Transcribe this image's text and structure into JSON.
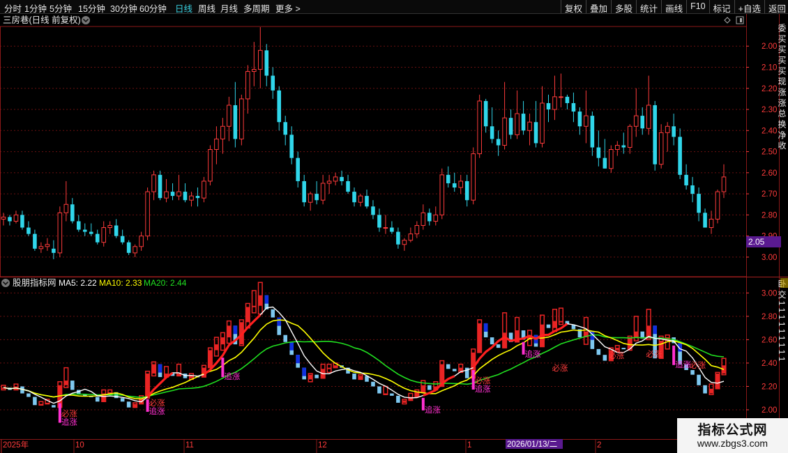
{
  "toolbar": {
    "items": [
      "分时",
      "1分钟",
      "5分钟",
      "15分钟",
      "30分钟",
      "60分钟",
      "日线",
      "周线",
      "月线",
      "多周期",
      "更多 >"
    ],
    "active_index": 6,
    "right_buttons": [
      "复权",
      "叠加",
      "多股",
      "统计",
      "画线",
      "F10",
      "标记",
      "+自选",
      "返回"
    ]
  },
  "main_chart": {
    "title": "三房巷(日线 前复权)",
    "y_ticks": [
      "3.00",
      "2.90",
      "2.80",
      "2.70",
      "2.60",
      "2.50",
      "2.40",
      "2.30",
      "2.20",
      "2.10",
      "2.00"
    ],
    "price_marker": "2.05",
    "side_text": "委 买 买 买 买 现 涨 涨 总 换 净 收"
  },
  "indicator": {
    "name": "股朋指标网",
    "ma5": "MA5: 2.22",
    "ma10": "MA10: 2.33",
    "ma20": "MA20: 2.44",
    "y_ticks": [
      "3.00",
      "2.80",
      "2.60",
      "2.40",
      "2.20",
      "2.00"
    ],
    "tag_up": "必涨",
    "tag_chase": "追涨",
    "side_text": "卧 交 1 1 1 1 1 1 1 1 1"
  },
  "time_axis": {
    "labels": [
      "2025年",
      "10",
      "11",
      "12",
      "1",
      "2"
    ],
    "cursor_label": "2026/01/13/二"
  },
  "watermark": {
    "title": "指标公式网",
    "url": "www.zbgs3.com"
  },
  "colors": {
    "up": "#ff3b3b",
    "down": "#30d6ea",
    "up_bar": "#e82424",
    "light_blue_bar": "#7ec8f0",
    "blue_bar": "#1030e0",
    "ma5": "#ffffff",
    "ma10": "#ffff00",
    "ma20": "#20e020",
    "tag": "#ff30d0",
    "grid": "#6b1010",
    "frame": "#8b1818"
  },
  "chart_data": [
    {
      "type": "candlestick",
      "title": "三房巷(日线 前复权)",
      "ylim": [
        1.97,
        3.08
      ],
      "y_ticks": [
        2.0,
        2.1,
        2.2,
        2.3,
        2.4,
        2.5,
        2.6,
        2.7,
        2.8,
        2.9,
        3.0
      ],
      "ohlc": [
        [
          2.18,
          2.21,
          2.15,
          2.19
        ],
        [
          2.19,
          2.2,
          2.15,
          2.17
        ],
        [
          2.17,
          2.22,
          2.16,
          2.2
        ],
        [
          2.2,
          2.22,
          2.13,
          2.14
        ],
        [
          2.14,
          2.17,
          2.1,
          2.11
        ],
        [
          2.11,
          2.13,
          2.03,
          2.04
        ],
        [
          2.04,
          2.07,
          2.02,
          2.05
        ],
        [
          2.05,
          2.09,
          2.03,
          2.06
        ],
        [
          2.04,
          2.08,
          1.99,
          2.02
        ],
        [
          2.02,
          2.24,
          2.0,
          2.21
        ],
        [
          2.21,
          2.36,
          2.17,
          2.25
        ],
        [
          2.25,
          2.28,
          2.16,
          2.17
        ],
        [
          2.17,
          2.2,
          2.12,
          2.13
        ],
        [
          2.13,
          2.16,
          2.1,
          2.12
        ],
        [
          2.12,
          2.16,
          2.1,
          2.11
        ],
        [
          2.11,
          2.13,
          2.06,
          2.07
        ],
        [
          2.07,
          2.17,
          2.05,
          2.14
        ],
        [
          2.14,
          2.17,
          2.11,
          2.15
        ],
        [
          2.15,
          2.18,
          2.09,
          2.1
        ],
        [
          2.1,
          2.13,
          2.06,
          2.07
        ],
        [
          2.07,
          2.08,
          2.01,
          2.02
        ],
        [
          2.02,
          2.06,
          2.0,
          2.05
        ],
        [
          2.05,
          2.12,
          2.03,
          2.1
        ],
        [
          2.1,
          2.33,
          2.08,
          2.31
        ],
        [
          2.31,
          2.41,
          2.27,
          2.39
        ],
        [
          2.39,
          2.41,
          2.27,
          2.28
        ],
        [
          2.28,
          2.37,
          2.26,
          2.31
        ],
        [
          2.31,
          2.35,
          2.27,
          2.29
        ],
        [
          2.29,
          2.39,
          2.27,
          2.31
        ],
        [
          2.31,
          2.35,
          2.26,
          2.27
        ],
        [
          2.27,
          2.31,
          2.24,
          2.29
        ],
        [
          2.29,
          2.33,
          2.24,
          2.28
        ],
        [
          2.28,
          2.38,
          2.26,
          2.36
        ],
        [
          2.36,
          2.53,
          2.34,
          2.51
        ],
        [
          2.51,
          2.62,
          2.44,
          2.56
        ],
        [
          2.56,
          2.66,
          2.49,
          2.62
        ],
        [
          2.62,
          2.76,
          2.55,
          2.72
        ],
        [
          2.72,
          2.83,
          2.52,
          2.56
        ],
        [
          2.56,
          2.77,
          2.53,
          2.75
        ],
        [
          2.75,
          2.91,
          2.68,
          2.88
        ],
        [
          2.88,
          3.02,
          2.81,
          2.89
        ],
        [
          2.89,
          3.09,
          2.8,
          2.98
        ],
        [
          2.98,
          3.01,
          2.81,
          2.86
        ],
        [
          2.86,
          2.9,
          2.75,
          2.79
        ],
        [
          2.79,
          2.81,
          2.6,
          2.64
        ],
        [
          2.64,
          2.67,
          2.53,
          2.58
        ],
        [
          2.58,
          2.62,
          2.44,
          2.47
        ],
        [
          2.47,
          2.5,
          2.33,
          2.36
        ],
        [
          2.36,
          2.39,
          2.24,
          2.26
        ],
        [
          2.26,
          2.31,
          2.22,
          2.3
        ],
        [
          2.3,
          2.36,
          2.25,
          2.27
        ],
        [
          2.27,
          2.39,
          2.25,
          2.35
        ],
        [
          2.35,
          2.39,
          2.3,
          2.36
        ],
        [
          2.36,
          2.4,
          2.34,
          2.38
        ],
        [
          2.38,
          2.41,
          2.34,
          2.36
        ],
        [
          2.36,
          2.39,
          2.3,
          2.31
        ],
        [
          2.31,
          2.33,
          2.24,
          2.26
        ],
        [
          2.26,
          2.3,
          2.24,
          2.29
        ],
        [
          2.29,
          2.32,
          2.23,
          2.24
        ],
        [
          2.24,
          2.27,
          2.18,
          2.2
        ],
        [
          2.2,
          2.23,
          2.12,
          2.14
        ],
        [
          2.14,
          2.2,
          2.11,
          2.14
        ],
        [
          2.14,
          2.17,
          2.11,
          2.12
        ],
        [
          2.12,
          2.14,
          2.04,
          2.06
        ],
        [
          2.06,
          2.09,
          2.03,
          2.08
        ],
        [
          2.08,
          2.14,
          2.07,
          2.11
        ],
        [
          2.11,
          2.17,
          2.09,
          2.15
        ],
        [
          2.15,
          2.25,
          2.13,
          2.21
        ],
        [
          2.21,
          2.23,
          2.15,
          2.17
        ],
        [
          2.17,
          2.24,
          2.15,
          2.2
        ],
        [
          2.2,
          2.42,
          2.18,
          2.39
        ],
        [
          2.39,
          2.43,
          2.33,
          2.35
        ],
        [
          2.35,
          2.4,
          2.31,
          2.33
        ],
        [
          2.33,
          2.39,
          2.3,
          2.36
        ],
        [
          2.36,
          2.39,
          2.24,
          2.27
        ],
        [
          2.27,
          2.52,
          2.25,
          2.49
        ],
        [
          2.49,
          2.77,
          2.47,
          2.74
        ],
        [
          2.74,
          2.75,
          2.59,
          2.62
        ],
        [
          2.62,
          2.71,
          2.54,
          2.56
        ],
        [
          2.56,
          2.6,
          2.48,
          2.53
        ],
        [
          2.53,
          2.83,
          2.51,
          2.66
        ],
        [
          2.66,
          2.7,
          2.56,
          2.58
        ],
        [
          2.58,
          2.79,
          2.56,
          2.68
        ],
        [
          2.68,
          2.74,
          2.58,
          2.6
        ],
        [
          2.6,
          2.68,
          2.53,
          2.64
        ],
        [
          2.64,
          2.74,
          2.52,
          2.54
        ],
        [
          2.54,
          2.81,
          2.52,
          2.73
        ],
        [
          2.73,
          2.77,
          2.64,
          2.7
        ],
        [
          2.7,
          2.86,
          2.65,
          2.76
        ],
        [
          2.76,
          2.87,
          2.71,
          2.76
        ],
        [
          2.76,
          2.77,
          2.7,
          2.73
        ],
        [
          2.73,
          2.78,
          2.64,
          2.69
        ],
        [
          2.69,
          2.71,
          2.58,
          2.62
        ],
        [
          2.62,
          2.79,
          2.54,
          2.67
        ],
        [
          2.67,
          2.69,
          2.48,
          2.52
        ],
        [
          2.52,
          2.6,
          2.43,
          2.47
        ],
        [
          2.47,
          2.56,
          2.42,
          2.42
        ],
        [
          2.42,
          2.53,
          2.4,
          2.51
        ],
        [
          2.51,
          2.55,
          2.48,
          2.53
        ],
        [
          2.53,
          2.59,
          2.49,
          2.52
        ],
        [
          2.52,
          2.63,
          2.49,
          2.62
        ],
        [
          2.62,
          2.8,
          2.57,
          2.67
        ],
        [
          2.67,
          2.71,
          2.58,
          2.61
        ],
        [
          2.61,
          2.86,
          2.58,
          2.72
        ],
        [
          2.72,
          2.74,
          2.41,
          2.44
        ],
        [
          2.44,
          2.63,
          2.42,
          2.59
        ],
        [
          2.59,
          2.64,
          2.5,
          2.62
        ],
        [
          2.62,
          2.68,
          2.53,
          2.57
        ],
        [
          2.57,
          2.61,
          2.37,
          2.39
        ],
        [
          2.39,
          2.44,
          2.32,
          2.34
        ],
        [
          2.34,
          2.38,
          2.26,
          2.3
        ],
        [
          2.3,
          2.33,
          2.17,
          2.21
        ],
        [
          2.21,
          2.23,
          2.15,
          2.14
        ],
        [
          2.14,
          2.22,
          2.11,
          2.18
        ],
        [
          2.18,
          2.32,
          2.16,
          2.31
        ],
        [
          2.31,
          2.44,
          2.28,
          2.38
        ]
      ]
    },
    {
      "type": "line",
      "title": "股朋指标网",
      "ylim": [
        1.97,
        3.02
      ],
      "series": [
        {
          "name": "MA5",
          "last": 2.22
        },
        {
          "name": "MA10",
          "last": 2.33
        },
        {
          "name": "MA20",
          "last": 2.44
        }
      ]
    }
  ]
}
